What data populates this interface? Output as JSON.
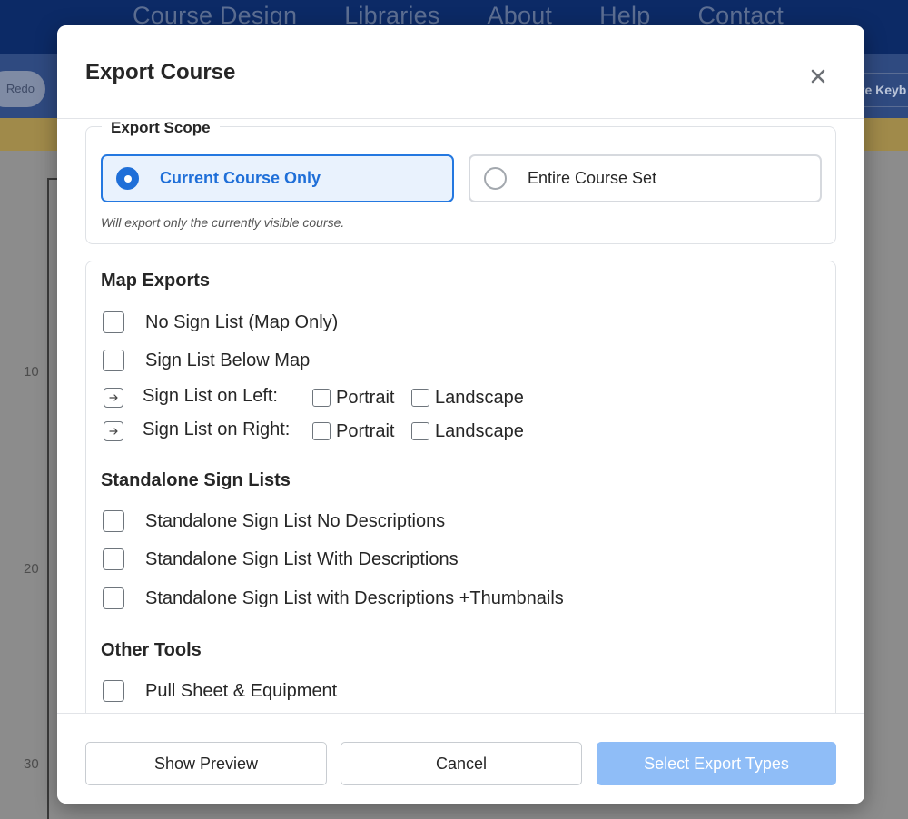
{
  "background": {
    "nav_items": [
      "Course Design",
      "Libraries",
      "About",
      "Help",
      "Contact"
    ],
    "redo_label": "Redo",
    "keyboard_label": "re Keyb",
    "ticks": [
      "10",
      "20",
      "30"
    ]
  },
  "modal": {
    "title": "Export Course",
    "scope": {
      "legend": "Export Scope",
      "options": [
        {
          "label": "Current Course Only",
          "selected": true
        },
        {
          "label": "Entire Course Set",
          "selected": false
        }
      ],
      "hint": "Will export only the currently visible course."
    },
    "map_exports": {
      "title": "Map Exports",
      "items": [
        {
          "label": "No Sign List (Map Only)"
        },
        {
          "label": "Sign List Below Map"
        }
      ],
      "side_items": [
        {
          "label": "Sign List on Left:",
          "portrait": "Portrait",
          "landscape": "Landscape"
        },
        {
          "label": "Sign List on Right:",
          "portrait": "Portrait",
          "landscape": "Landscape"
        }
      ]
    },
    "standalone": {
      "title": "Standalone Sign Lists",
      "items": [
        {
          "label": "Standalone Sign List No Descriptions"
        },
        {
          "label": "Standalone Sign List With Descriptions"
        },
        {
          "label": "Standalone Sign List with Descriptions +Thumbnails"
        }
      ]
    },
    "other_tools": {
      "title": "Other Tools",
      "items": [
        {
          "label": "Pull Sheet & Equipment"
        }
      ]
    },
    "footer": {
      "show_preview": "Show Preview",
      "cancel": "Cancel",
      "select_export_types": "Select Export Types"
    }
  },
  "colors": {
    "accent": "#1f6fd8",
    "accent_bg": "#e9f2fd",
    "primary_disabled": "#8fbdf7"
  }
}
